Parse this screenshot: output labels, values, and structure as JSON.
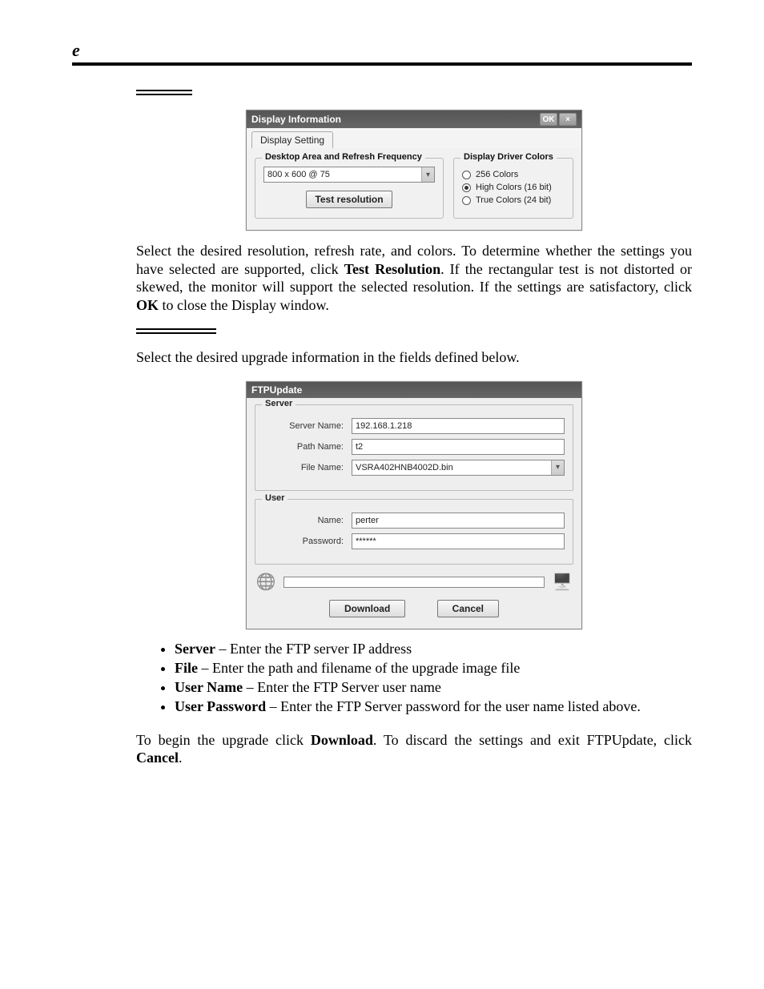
{
  "page_marker": "e",
  "display_dialog": {
    "title": "Display Information",
    "ok": "OK",
    "close": "×",
    "tab": "Display Setting",
    "group_resolution_legend": "Desktop Area and Refresh Frequency",
    "resolution_value": "800 x 600 @ 75",
    "test_btn": "Test resolution",
    "group_colors_legend": "Display Driver Colors",
    "radios": {
      "r256": "256 Colors",
      "r16": "High Colors (16 bit)",
      "r24": "True Colors (24 bit)"
    }
  },
  "para_display": "Select the desired resolution, refresh rate, and colors. To determine whether the settings you have selected are supported, click Test Resolution. If the rectangular test is not distorted or skewed, the monitor will support the selected resolution. If the settings are satisfactory, click OK to close the Display window.",
  "para_display_bold1": "Test Resolution",
  "para_display_bold2": "OK",
  "para_upgrade_intro": "Select the desired upgrade information in the fields defined below.",
  "ftp_dialog": {
    "title": "FTPUpdate",
    "server_legend": "Server",
    "user_legend": "User",
    "labels": {
      "server_name": "Server Name:",
      "path_name": "Path Name:",
      "file_name": "File Name:",
      "name": "Name:",
      "password": "Password:"
    },
    "values": {
      "server_name": "192.168.1.218",
      "path_name": "t2",
      "file_name": "VSRA402HNB4002D.bin",
      "name": "perter",
      "password": "******"
    },
    "download": "Download",
    "cancel": "Cancel"
  },
  "definitions": {
    "server_b": "Server",
    "server_t": " – Enter the FTP server IP address",
    "file_b": "File",
    "file_t": " – Enter the path and filename of the upgrade image file",
    "uname_b": "User Name",
    "uname_t": " – Enter the FTP Server user name",
    "upass_b": "User Password",
    "upass_t": " – Enter the FTP Server password for the user name listed above."
  },
  "para_footer_pre": "To begin the upgrade click ",
  "para_footer_b1": "Download",
  "para_footer_mid": ". To discard the settings and exit FTPUpdate, click ",
  "para_footer_b2": "Cancel",
  "para_footer_end": "."
}
